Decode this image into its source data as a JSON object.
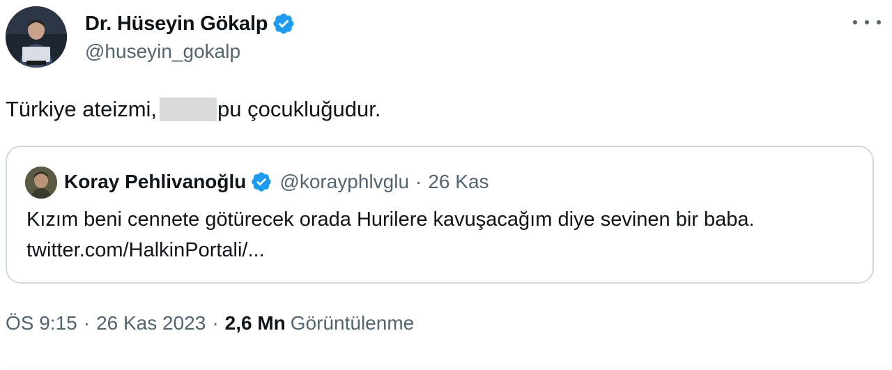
{
  "author": {
    "name": "Dr. Hüseyin Gökalp",
    "handle": "@huseyin_gokalp",
    "verified": true
  },
  "tweet": {
    "text_before": "Türkiye ateizmi,",
    "text_after": "pu çocukluğudur."
  },
  "quote": {
    "name": "Koray Pehlivanoğlu",
    "handle": "@korayphlvglu",
    "separator": "·",
    "date": "26 Kas",
    "text": "Kızım beni cennete götürecek orada Hurilere kavuşacağım diye sevinen bir baba. twitter.com/HalkinPortali/..."
  },
  "meta": {
    "time": "ÖS 9:15",
    "separator": "·",
    "date": "26 Kas 2023",
    "views_count": "2,6 Mn",
    "views_label": "Görüntülenme"
  },
  "colors": {
    "verified_blue": "#1d9bf0",
    "secondary_text": "#536471",
    "border": "#cfd9de"
  },
  "icons": [
    "verified-badge-icon",
    "more-options-icon"
  ]
}
